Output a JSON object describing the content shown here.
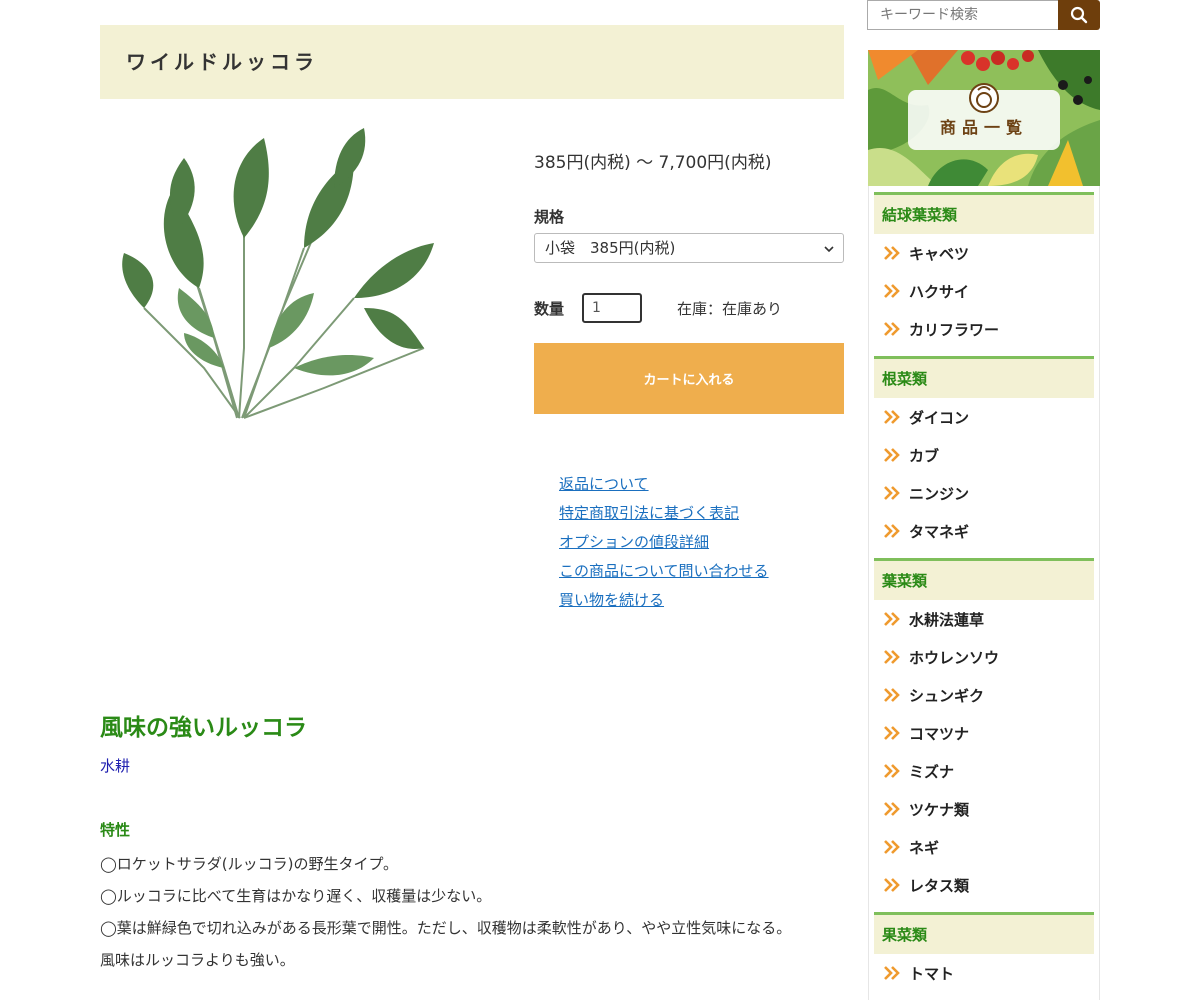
{
  "product": {
    "title": "ワイルドルッコラ",
    "price_range": "385円(内税) 〜 7,700円(内税)",
    "spec_label": "規格",
    "spec_selected": "小袋　385円(内税)",
    "qty_label": "数量",
    "qty_value": "1",
    "stock_text": "在庫：在庫あり",
    "cart_button": "カートに入れる"
  },
  "links": [
    "返品について",
    "特定商取引法に基づく表記",
    "オプションの値段詳細",
    "この商品について問い合わせる",
    "買い物を続ける"
  ],
  "description": {
    "heading": "風味の強いルッコラ",
    "tag": "水耕",
    "feature_heading": "特性",
    "lines": [
      "◯ロケットサラダ(ルッコラ)の野生タイプ。",
      "◯ルッコラに比べて生育はかなり遅く、収穫量は少ない。",
      "◯葉は鮮緑色で切れ込みがある長形葉で開性。ただし、収穫物は柔軟性があり、やや立性気味になる。",
      "風味はルッコラよりも強い。"
    ]
  },
  "search": {
    "placeholder": "キーワード検索"
  },
  "banner": {
    "label": "商品一覧"
  },
  "categories": [
    {
      "name": "結球葉菜類",
      "items": [
        "キャベツ",
        "ハクサイ",
        "カリフラワー"
      ]
    },
    {
      "name": "根菜類",
      "items": [
        "ダイコン",
        "カブ",
        "ニンジン",
        "タマネギ"
      ]
    },
    {
      "name": "葉菜類",
      "items": [
        "水耕法蓮草",
        "ホウレンソウ",
        "シュンギク",
        "コマツナ",
        "ミズナ",
        "ツケナ類",
        "ネギ",
        "レタス類"
      ]
    },
    {
      "name": "果菜類",
      "items": [
        "トマト"
      ]
    }
  ],
  "colors": {
    "accent_green": "#2a8a16",
    "title_bg": "#f3f1d4",
    "cart_orange": "#efae4d",
    "search_brown": "#6e3e0c",
    "link_blue": "#1a6fbf"
  },
  "icons": {
    "search": "search-icon",
    "list_bullet": "double-chevron-right-icon",
    "select": "chevron-down-icon"
  }
}
